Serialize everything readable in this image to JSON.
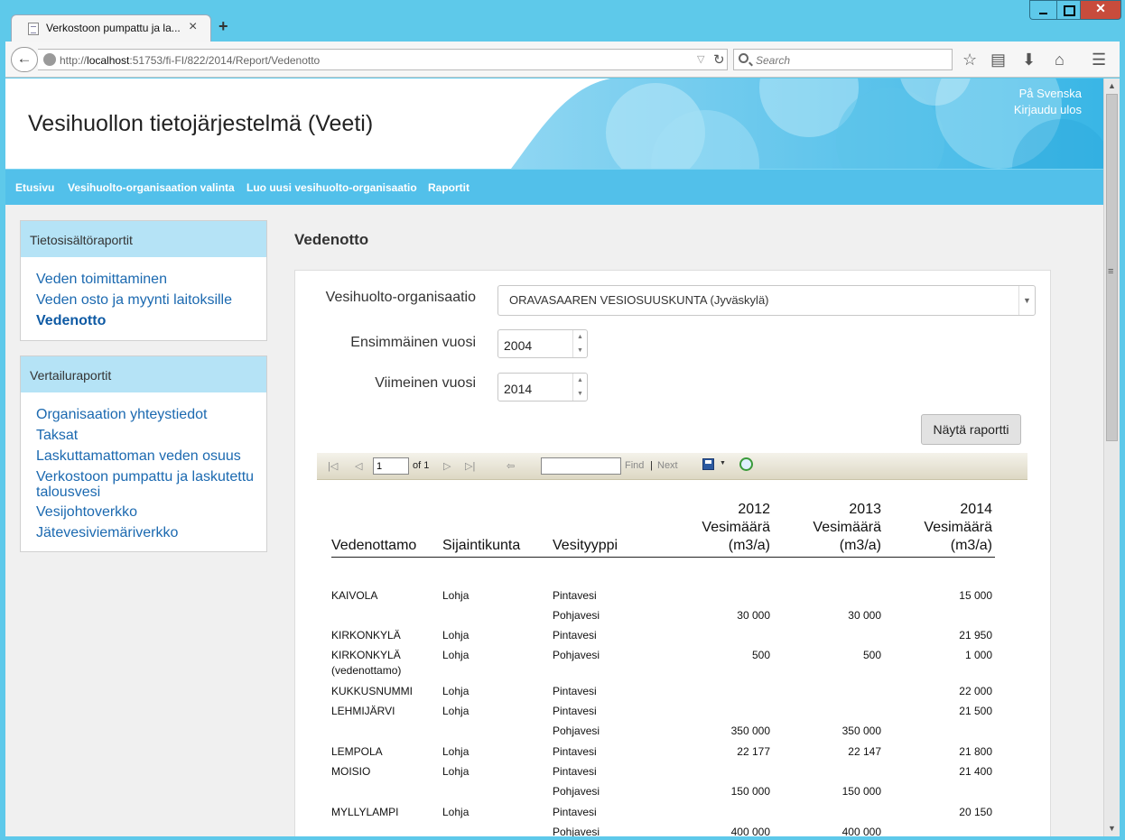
{
  "browser": {
    "tab_title": "Verkostoon pumpattu ja la...",
    "url_prefix": "http://",
    "url_host": "localhost",
    "url_rest": ":51753/fi-FI/822/2014/Report/Vedenotto",
    "search_placeholder": "Search"
  },
  "header": {
    "site_title": "Vesihuollon tietojärjestelmä (Veeti)",
    "lang_link": "På Svenska",
    "logout_link": "Kirjaudu ulos"
  },
  "mainnav": [
    "Etusivu",
    "Vesihuolto-organisaation valinta",
    "Luo uusi vesihuolto-organisaatio",
    "Raportit"
  ],
  "sidebar": {
    "box1_title": "Tietosisältöraportit",
    "box1_links": [
      "Veden toimittaminen",
      "Veden osto ja myynti laitoksille",
      "Vedenotto"
    ],
    "box2_title": "Vertailuraportit",
    "box2_links": [
      "Organisaation yhteystiedot",
      "Taksat",
      "Laskuttamattoman veden osuus",
      "Verkostoon pumpattu ja laskutettu",
      "talousvesi",
      "Vesijohtoverkko",
      "Jätevesiviemäriverkko"
    ]
  },
  "form": {
    "page_title": "Vedenotto",
    "org_label": "Vesihuolto-organisaatio",
    "org_value": "ORAVASAAREN VESIOSUUSKUNTA (Jyväskylä)",
    "first_year_label": "Ensimmäinen vuosi",
    "first_year_value": "2004",
    "last_year_label": "Viimeinen vuosi",
    "last_year_value": "2014",
    "show_button": "Näytä raportti"
  },
  "report_toolbar": {
    "page_value": "1",
    "of_text": "of 1",
    "find": "Find",
    "separator": "|",
    "next": "Next"
  },
  "report": {
    "headers": {
      "vedenottamo": "Vedenottamo",
      "sijaintikunta": "Sijaintikunta",
      "vesityyppi": "Vesityyppi",
      "years": [
        "2012",
        "2013",
        "2014"
      ],
      "amount_label": "Vesimäärä",
      "unit": "(m3/a)"
    },
    "rows": [
      {
        "name": "KAIVOLA",
        "kunta": "Lohja",
        "type": "Pintavesi",
        "v2012": "",
        "v2013": "",
        "v2014": "15 000"
      },
      {
        "name": "",
        "kunta": "",
        "type": "Pohjavesi",
        "v2012": "30 000",
        "v2013": "30 000",
        "v2014": ""
      },
      {
        "name": "KIRKONKYLÄ",
        "kunta": "Lohja",
        "type": "Pintavesi",
        "v2012": "",
        "v2013": "",
        "v2014": "21 950"
      },
      {
        "name": "KIRKONKYLÄ",
        "kunta": "Lohja",
        "type": "Pohjavesi",
        "v2012": "500",
        "v2013": "500",
        "v2014": "1 000"
      },
      {
        "name": "(vedenottamo)",
        "kunta": "",
        "type": "",
        "v2012": "",
        "v2013": "",
        "v2014": ""
      },
      {
        "name": "KUKKUSNUMMI",
        "kunta": "Lohja",
        "type": "Pintavesi",
        "v2012": "",
        "v2013": "",
        "v2014": "22 000"
      },
      {
        "name": "LEHMIJÄRVI",
        "kunta": "Lohja",
        "type": "Pintavesi",
        "v2012": "",
        "v2013": "",
        "v2014": "21 500"
      },
      {
        "name": "",
        "kunta": "",
        "type": "Pohjavesi",
        "v2012": "350 000",
        "v2013": "350 000",
        "v2014": ""
      },
      {
        "name": "LEMPOLA",
        "kunta": "Lohja",
        "type": "Pintavesi",
        "v2012": "22 177",
        "v2013": "22 147",
        "v2014": "21 800"
      },
      {
        "name": "MOISIO",
        "kunta": "Lohja",
        "type": "Pintavesi",
        "v2012": "",
        "v2013": "",
        "v2014": "21 400"
      },
      {
        "name": "",
        "kunta": "",
        "type": "Pohjavesi",
        "v2012": "150 000",
        "v2013": "150 000",
        "v2014": ""
      },
      {
        "name": "MYLLYLAMPI",
        "kunta": "Lohja",
        "type": "Pintavesi",
        "v2012": "",
        "v2013": "",
        "v2014": "20 150"
      },
      {
        "name": "",
        "kunta": "",
        "type": "Pohjavesi",
        "v2012": "400 000",
        "v2013": "400 000",
        "v2014": ""
      }
    ]
  }
}
